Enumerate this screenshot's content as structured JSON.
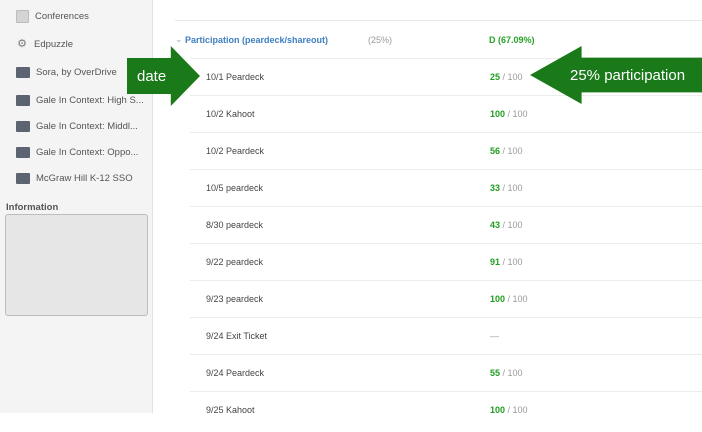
{
  "sidebar": {
    "items": [
      {
        "label": "Conferences",
        "icon": "calendar-icon"
      },
      {
        "label": "Edpuzzle",
        "icon": "puzzle-icon"
      },
      {
        "label": "Sora, by OverDrive",
        "icon": "app-icon"
      },
      {
        "label": "Gale In Context: High S...",
        "icon": "app-icon"
      },
      {
        "label": "Gale In Context: Middl...",
        "icon": "app-icon"
      },
      {
        "label": "Gale In Context: Oppo...",
        "icon": "app-icon"
      },
      {
        "label": "McGraw Hill K-12 SSO",
        "icon": "app-icon"
      }
    ],
    "info_heading": "Information"
  },
  "category": {
    "name": "Participation (peardeck/shareout)",
    "weight": "(25%)",
    "grade": "D (67.09%)"
  },
  "assignments": [
    {
      "name": "10/1 Peardeck",
      "earned": "25",
      "out_of": "/ 100"
    },
    {
      "name": "10/2 Kahoot",
      "earned": "100",
      "out_of": "/ 100"
    },
    {
      "name": "10/2 Peardeck",
      "earned": "56",
      "out_of": "/ 100"
    },
    {
      "name": "10/5 peardeck",
      "earned": "33",
      "out_of": "/ 100"
    },
    {
      "name": "8/30 peardeck",
      "earned": "43",
      "out_of": "/ 100"
    },
    {
      "name": "9/22 peardeck",
      "earned": "91",
      "out_of": "/ 100"
    },
    {
      "name": "9/23 peardeck",
      "earned": "100",
      "out_of": "/ 100"
    },
    {
      "name": "9/24 Exit Ticket",
      "earned": "",
      "out_of": "—"
    },
    {
      "name": "9/24 Peardeck",
      "earned": "55",
      "out_of": "/ 100"
    },
    {
      "name": "9/25 Kahoot",
      "earned": "100",
      "out_of": "/ 100"
    }
  ],
  "annotations": {
    "date_label": "date",
    "participation_label": "25% participation"
  },
  "colors": {
    "arrow": "#1a7a1a",
    "category_link": "#3f7fc1",
    "score_green": "#1f9e1f"
  }
}
